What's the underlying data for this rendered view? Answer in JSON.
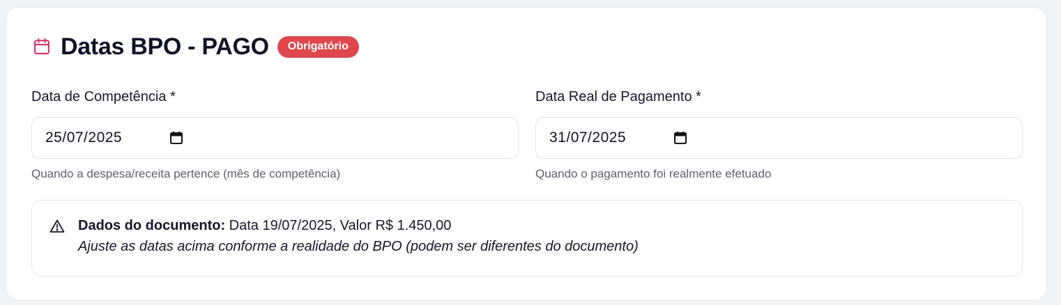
{
  "section": {
    "title": "Datas BPO - PAGO",
    "badge": "Obrigatório",
    "icon": "calendar-icon",
    "accent_color": "#d6336c",
    "badge_color": "#e0474c"
  },
  "fields": [
    {
      "label": "Data de Competência *",
      "value": "25/07/2025",
      "hint": "Quando a despesa/receita pertence (mês de competência)",
      "icon": "calendar-picker-icon"
    },
    {
      "label": "Data Real de Pagamento *",
      "value": "31/07/2025",
      "hint": "Quando o pagamento foi realmente efetuado",
      "icon": "calendar-picker-icon"
    }
  ],
  "alert": {
    "icon": "warning-icon",
    "heading": "Dados do documento:",
    "details": "Data 19/07/2025, Valor R$ 1.450,00",
    "note": "Ajuste as datas acima conforme a realidade do BPO (podem ser diferentes do documento)"
  }
}
